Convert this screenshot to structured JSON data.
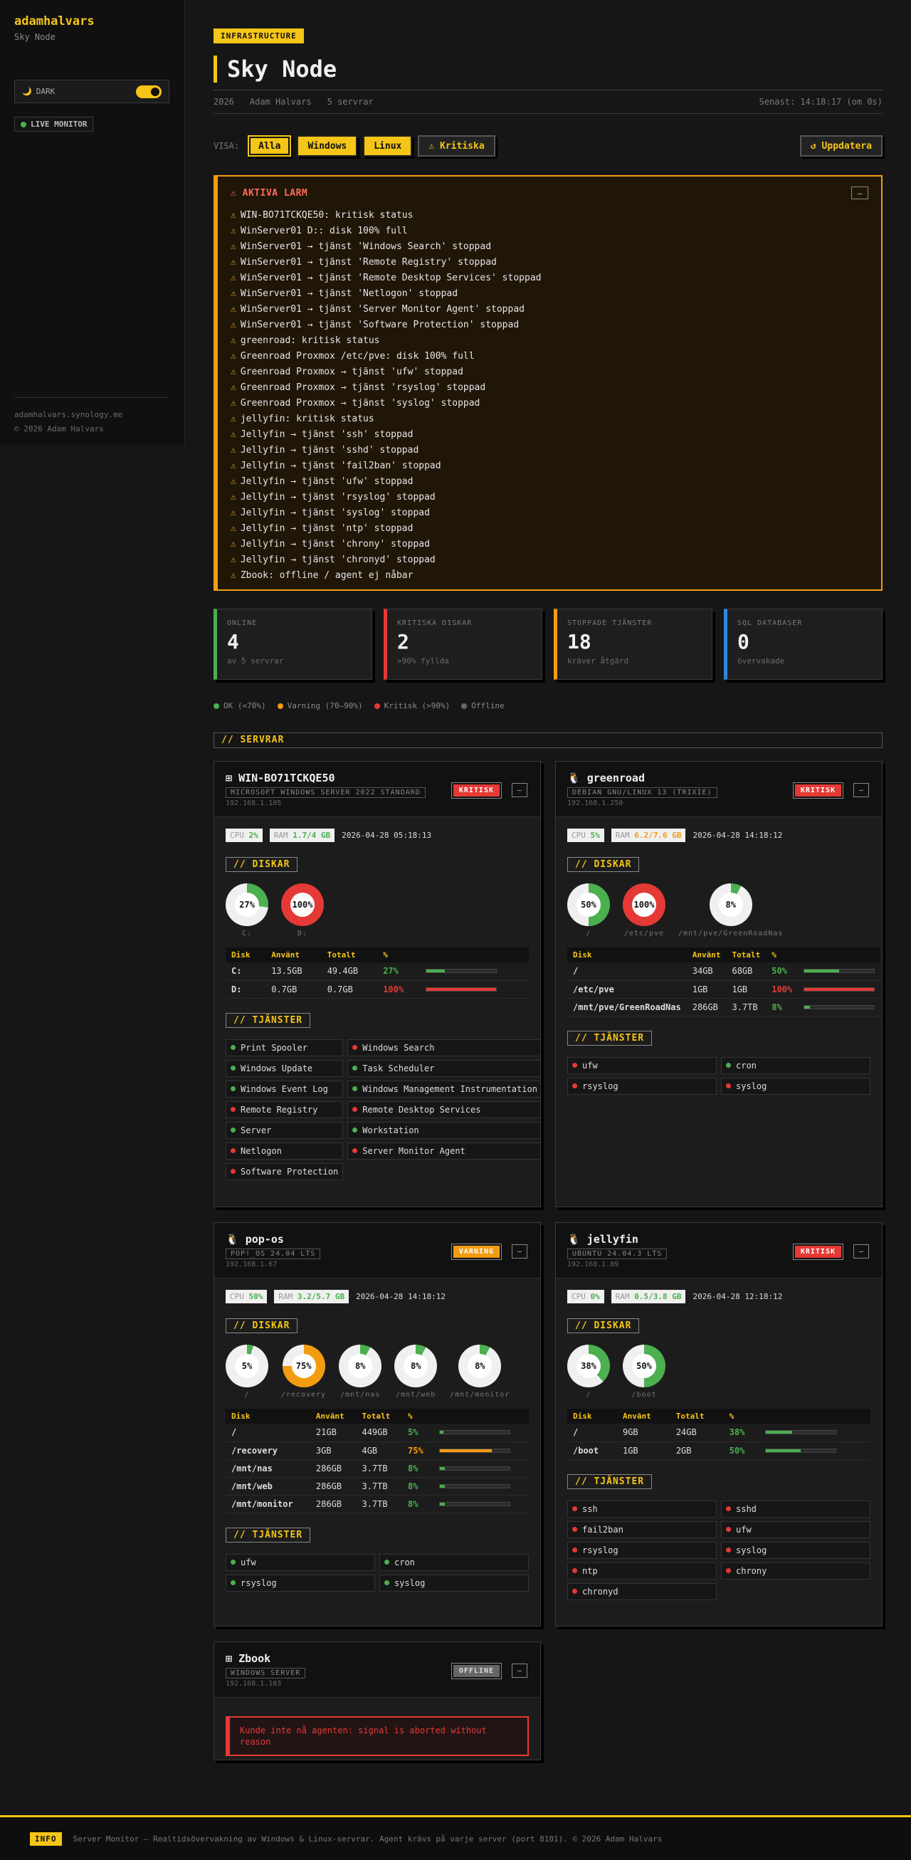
{
  "sidebar": {
    "brand": "adamhalvars",
    "subtitle": "Sky Node",
    "theme_icon": "🌙",
    "theme_label": "DARK",
    "live_label": "LIVE MONITOR",
    "footer_link": "adamhalvars.synology.me",
    "footer_copy": "© 2026 Adam Halvars"
  },
  "header": {
    "tag": "INFRASTRUCTURE",
    "title": "Sky Node",
    "year": "2026",
    "author": "Adam Halvars",
    "server_count": "5 servrar",
    "last_update": "Senast: 14:18:17 (om 0s)"
  },
  "filters": {
    "label": "VISA:",
    "all": "Alla",
    "windows": "Windows",
    "linux": "Linux",
    "critical": "⚠ Kritiska",
    "refresh": "↺ Uppdatera"
  },
  "alarms": {
    "title": "⚠ AKTIVA LARM",
    "collapse": "–",
    "icon": "⚠",
    "items": [
      "WIN-BO71TCKQE50: kritisk status",
      "WinServer01 D:: disk 100% full",
      "WinServer01 → tjänst 'Windows Search' stoppad",
      "WinServer01 → tjänst 'Remote Registry' stoppad",
      "WinServer01 → tjänst 'Remote Desktop Services' stoppad",
      "WinServer01 → tjänst 'Netlogon' stoppad",
      "WinServer01 → tjänst 'Server Monitor Agent' stoppad",
      "WinServer01 → tjänst 'Software Protection' stoppad",
      "greenroad: kritisk status",
      "Greenroad Proxmox /etc/pve: disk 100% full",
      "Greenroad Proxmox → tjänst 'ufw' stoppad",
      "Greenroad Proxmox → tjänst 'rsyslog' stoppad",
      "Greenroad Proxmox → tjänst 'syslog' stoppad",
      "jellyfin: kritisk status",
      "Jellyfin → tjänst 'ssh' stoppad",
      "Jellyfin → tjänst 'sshd' stoppad",
      "Jellyfin → tjänst 'fail2ban' stoppad",
      "Jellyfin → tjänst 'ufw' stoppad",
      "Jellyfin → tjänst 'rsyslog' stoppad",
      "Jellyfin → tjänst 'syslog' stoppad",
      "Jellyfin → tjänst 'ntp' stoppad",
      "Jellyfin → tjänst 'chrony' stoppad",
      "Jellyfin → tjänst 'chronyd' stoppad",
      "Zbook: offline / agent ej nåbar"
    ]
  },
  "stats": [
    {
      "label": "ONLINE",
      "value": "4",
      "sub": "av 5 servrar",
      "color": "#4caf50"
    },
    {
      "label": "KRITISKA DISKAR",
      "value": "2",
      "sub": ">90% fyllda",
      "color": "#e53935"
    },
    {
      "label": "STOPPADE TJÄNSTER",
      "value": "18",
      "sub": "kräver åtgärd",
      "color": "#f39c12"
    },
    {
      "label": "SQL DATABASER",
      "value": "0",
      "sub": "övervakade",
      "color": "#2e86de"
    }
  ],
  "legend": {
    "ok": "OK (<70%)",
    "warn": "Varning (70–90%)",
    "crit": "Kritisk (>90%)",
    "off": "Offline"
  },
  "section_title": "// SERVRAR",
  "labels": {
    "disks": "// DISKAR",
    "services": "// TJÄNSTER",
    "col_disk": "Disk",
    "col_used": "Använt",
    "col_total": "Totalt",
    "col_pct": "%",
    "cpu": "CPU",
    "ram": "RAM",
    "collapse": "–"
  },
  "colors": {
    "ok": "#4caf50",
    "warn": "#f39c12",
    "crit": "#e53935",
    "ring_bg": "#f0f0f0"
  },
  "servers": [
    {
      "icon": "⊞",
      "name": "WIN-BO71TCKQE50",
      "os": "MICROSOFT WINDOWS SERVER 2022 STANDARD",
      "ip": "192.168.1.105",
      "status": "KRITISK",
      "cpu": "2%",
      "ram": "1.7/4 GB",
      "time": "2026-04-28 05:18:13",
      "disks": [
        {
          "name": "C:",
          "used": "13.5GB",
          "total": "49.4GB",
          "pct": 27,
          "pct_label": "27%"
        },
        {
          "name": "D:",
          "used": "0.7GB",
          "total": "0.7GB",
          "pct": 100,
          "pct_label": "100%"
        }
      ],
      "services": [
        {
          "name": "Print Spooler",
          "ok": true
        },
        {
          "name": "Windows Search",
          "ok": false
        },
        {
          "name": "Windows Update",
          "ok": true
        },
        {
          "name": "Task Scheduler",
          "ok": true
        },
        {
          "name": "Windows Event Log",
          "ok": true
        },
        {
          "name": "Windows Management Instrumentation",
          "ok": true
        },
        {
          "name": "Remote Registry",
          "ok": false
        },
        {
          "name": "Remote Desktop Services",
          "ok": false
        },
        {
          "name": "Server",
          "ok": true
        },
        {
          "name": "Workstation",
          "ok": true
        },
        {
          "name": "Netlogon",
          "ok": false
        },
        {
          "name": "Server Monitor Agent",
          "ok": false
        },
        {
          "name": "Software Protection",
          "ok": false
        }
      ]
    },
    {
      "icon": "🐧",
      "name": "greenroad",
      "os": "DEBIAN GNU/LINUX 13 (TRIXIE)",
      "ip": "192.168.1.250",
      "status": "KRITISK",
      "cpu": "5%",
      "ram": "6.2/7.6 GB",
      "ram_warn": true,
      "time": "2026-04-28 14:18:12",
      "disks": [
        {
          "name": "/",
          "used": "34GB",
          "total": "68GB",
          "pct": 50,
          "pct_label": "50%"
        },
        {
          "name": "/etc/pve",
          "used": "1GB",
          "total": "1GB",
          "pct": 100,
          "pct_label": "100%"
        },
        {
          "name": "/mnt/pve/GreenRoadNas",
          "used": "286GB",
          "total": "3.7TB",
          "pct": 8,
          "pct_label": "8%"
        }
      ],
      "services": [
        {
          "name": "ufw",
          "ok": false
        },
        {
          "name": "cron",
          "ok": true
        },
        {
          "name": "rsyslog",
          "ok": false
        },
        {
          "name": "syslog",
          "ok": false
        }
      ]
    },
    {
      "icon": "🐧",
      "name": "pop-os",
      "os": "POP!_OS 24.04 LTS",
      "ip": "192.168.1.67",
      "status": "VARNING",
      "cpu": "50%",
      "ram": "3.2/5.7 GB",
      "time": "2026-04-28 14:18:12",
      "disks": [
        {
          "name": "/",
          "used": "21GB",
          "total": "449GB",
          "pct": 5,
          "pct_label": "5%"
        },
        {
          "name": "/recovery",
          "used": "3GB",
          "total": "4GB",
          "pct": 75,
          "pct_label": "75%"
        },
        {
          "name": "/mnt/nas",
          "used": "286GB",
          "total": "3.7TB",
          "pct": 8,
          "pct_label": "8%"
        },
        {
          "name": "/mnt/web",
          "used": "286GB",
          "total": "3.7TB",
          "pct": 8,
          "pct_label": "8%"
        },
        {
          "name": "/mnt/monitor",
          "used": "286GB",
          "total": "3.7TB",
          "pct": 8,
          "pct_label": "8%"
        }
      ],
      "services": [
        {
          "name": "ufw",
          "ok": true
        },
        {
          "name": "cron",
          "ok": true
        },
        {
          "name": "rsyslog",
          "ok": true
        },
        {
          "name": "syslog",
          "ok": true
        }
      ]
    },
    {
      "icon": "🐧",
      "name": "jellyfin",
      "os": "UBUNTU 24.04.3 LTS",
      "ip": "192.168.1.89",
      "status": "KRITISK",
      "cpu": "0%",
      "ram": "0.5/3.8 GB",
      "time": "2026-04-28 12:18:12",
      "disks": [
        {
          "name": "/",
          "used": "9GB",
          "total": "24GB",
          "pct": 38,
          "pct_label": "38%"
        },
        {
          "name": "/boot",
          "used": "1GB",
          "total": "2GB",
          "pct": 50,
          "pct_label": "50%"
        }
      ],
      "services": [
        {
          "name": "ssh",
          "ok": false
        },
        {
          "name": "sshd",
          "ok": false
        },
        {
          "name": "fail2ban",
          "ok": false
        },
        {
          "name": "ufw",
          "ok": false
        },
        {
          "name": "rsyslog",
          "ok": false
        },
        {
          "name": "syslog",
          "ok": false
        },
        {
          "name": "ntp",
          "ok": false
        },
        {
          "name": "chrony",
          "ok": false
        },
        {
          "name": "chronyd",
          "ok": false
        }
      ]
    },
    {
      "icon": "⊞",
      "name": "Zbook",
      "os": "WINDOWS SERVER",
      "ip": "192.168.1.103",
      "status": "OFFLINE",
      "error": "Kunde inte nå agenten: signal is aborted without reason"
    }
  ],
  "footer": {
    "badge": "INFO",
    "text": "Server Monitor — Realtidsövervakning av Windows & Linux-servrar. Agent krävs på varje server (port 8101). © 2026 Adam Halvars"
  }
}
